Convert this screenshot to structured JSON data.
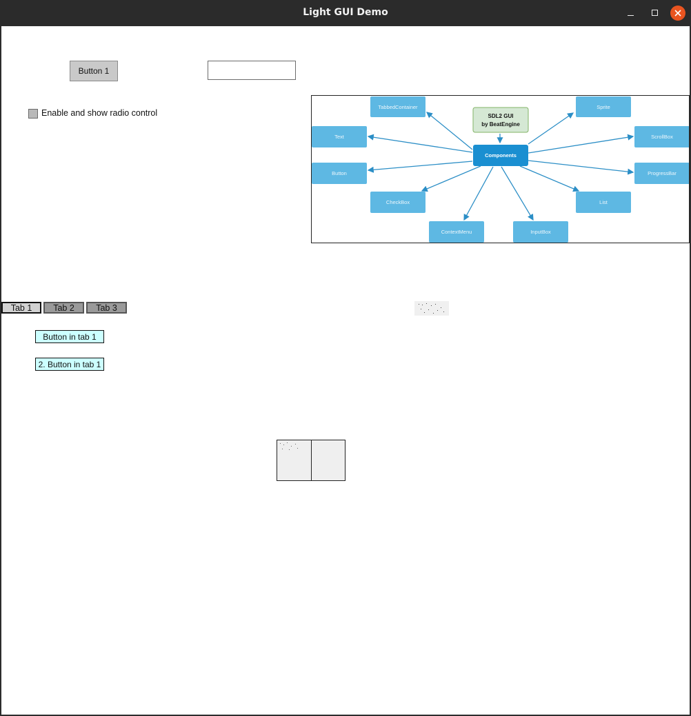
{
  "window": {
    "title": "Light GUI Demo",
    "controls": [
      "minimize-icon",
      "maximize-icon",
      "close-icon"
    ],
    "accent_close": "#e95420"
  },
  "main": {
    "button1_label": "Button 1",
    "input1": {
      "value": "",
      "placeholder": ""
    },
    "checkbox": {
      "label": "Enable and show radio control",
      "checked": false
    }
  },
  "diagram": {
    "center": "Components",
    "header_line1": "SDL2 GUI",
    "header_line2": "by BeatEngine",
    "nodes": {
      "tabbed_container": "TabbedContainer",
      "text": "Text",
      "button": "Button",
      "checkbox": "CheckBox",
      "context_menu": "ContextMenu",
      "input_box": "InputBox",
      "list": "List",
      "progress_bar": "ProgressBar",
      "scroll_box": "ScrollBox",
      "sprite": "Sprite"
    },
    "colors": {
      "node": "#5eb8e3",
      "center": "#1a8fd1",
      "header_fill": "#d5e8d4",
      "header_border": "#82b366",
      "arrow": "#2b8ec6"
    }
  },
  "tabs": {
    "items": [
      {
        "label": "Tab 1",
        "active": true
      },
      {
        "label": "Tab 2",
        "active": false
      },
      {
        "label": "Tab 3",
        "active": false
      }
    ],
    "tab1_buttons": [
      "Button in tab 1",
      "2. Button in tab 1"
    ],
    "button_color": "#ccffff"
  }
}
